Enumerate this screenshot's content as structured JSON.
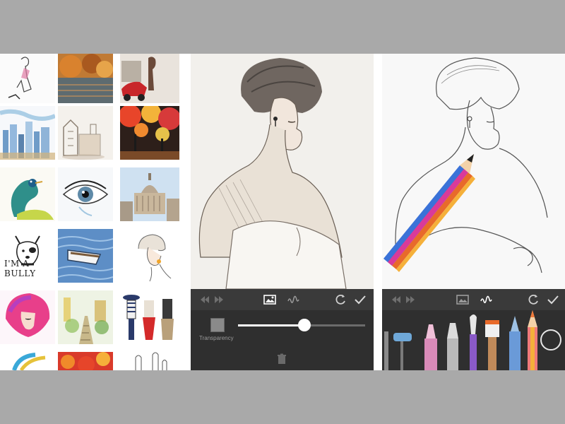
{
  "gallery": {
    "bully_caption": "I'M A BULLY"
  },
  "editor_transparency": {
    "label": "Transparency",
    "slider_value_fraction": 0.52,
    "toolbar": {
      "undo": "undo-icon",
      "redo": "redo-icon",
      "image": "image-icon",
      "brush": "brush-icon",
      "rotate": "rotate-icon",
      "confirm": "check-icon"
    }
  },
  "editor_brushes": {
    "toolbar": {
      "undo": "undo-icon",
      "redo": "redo-icon",
      "image": "image-icon",
      "brush": "brush-icon",
      "rotate": "rotate-icon",
      "confirm": "check-icon"
    }
  },
  "colors": {
    "page_background": "#a9a9a9",
    "toolbar_dark": "#2f2f2f",
    "toolbar_top": "#3a3a3a",
    "icon_gray": "#9b9b9b",
    "icon_white": "#ffffff"
  }
}
